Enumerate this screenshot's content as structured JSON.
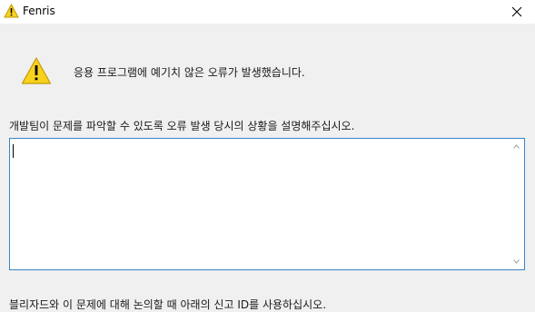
{
  "window": {
    "title": "Fenris",
    "title_icon": "warning-icon",
    "close_icon": "close-icon"
  },
  "dialog": {
    "icon": "warning-icon",
    "message": "응용 프로그램에 예기치 않은 오류가 발생했습니다.",
    "prompt": "개발팀이 문제를 파악할 수 있도록 오류 발생 당시의 상황을 설명해주십시오.",
    "description_value": "",
    "footer_text": "블리자드와 이 문제에 대해 논의할 때 아래의 신고 ID를 사용하십시오."
  },
  "colors": {
    "warning_fill": "#f7d21e",
    "warning_stroke": "#c79a00",
    "textarea_border": "#3c84c8",
    "background": "#f0f0f0"
  }
}
